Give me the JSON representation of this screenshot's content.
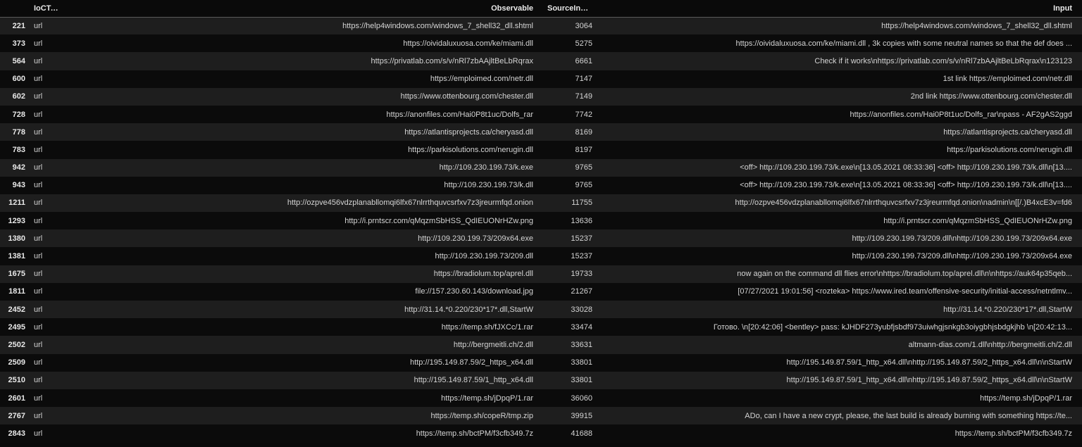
{
  "table": {
    "headers": {
      "index": "",
      "ioc_type": "IoCType",
      "observable": "Observable",
      "source_index": "SourceIndex",
      "input": "Input"
    },
    "rows": [
      {
        "index": "221",
        "ioc_type": "url",
        "observable": "https://help4windows.com/windows_7_shell32_dll.shtml",
        "source_index": "3064",
        "input": "https://help4windows.com/windows_7_shell32_dll.shtml"
      },
      {
        "index": "373",
        "ioc_type": "url",
        "observable": "https://oividaluxuosa.com/ke/miami.dll",
        "source_index": "5275",
        "input": "https://oividaluxuosa.com/ke/miami.dll , 3k copies with some neutral names so that the def does ..."
      },
      {
        "index": "564",
        "ioc_type": "url",
        "observable": "https://privatlab.com/s/v/nRl7zbAAjltBeLbRqrax",
        "source_index": "6661",
        "input": "Check if it works\\nhttps://privatlab.com/s/v/nRl7zbAAjltBeLbRqrax\\n123123"
      },
      {
        "index": "600",
        "ioc_type": "url",
        "observable": "https://emploimed.com/netr.dll",
        "source_index": "7147",
        "input": "1st link https://emploimed.com/netr.dll"
      },
      {
        "index": "602",
        "ioc_type": "url",
        "observable": "https://www.ottenbourg.com/chester.dll",
        "source_index": "7149",
        "input": "2nd link https://www.ottenbourg.com/chester.dll"
      },
      {
        "index": "728",
        "ioc_type": "url",
        "observable": "https://anonfiles.com/Hai0P8t1uc/Dolfs_rar",
        "source_index": "7742",
        "input": "https://anonfiles.com/Hai0P8t1uc/Dolfs_rar\\npass - AF2gAS2ggd"
      },
      {
        "index": "778",
        "ioc_type": "url",
        "observable": "https://atlantisprojects.ca/cheryasd.dll",
        "source_index": "8169",
        "input": "https://atlantisprojects.ca/cheryasd.dll"
      },
      {
        "index": "783",
        "ioc_type": "url",
        "observable": "https://parkisolutions.com/nerugin.dll",
        "source_index": "8197",
        "input": "https://parkisolutions.com/nerugin.dll"
      },
      {
        "index": "942",
        "ioc_type": "url",
        "observable": "http://109.230.199.73/k.exe",
        "source_index": "9765",
        "input": "<off> http://109.230.199.73/k.exe\\n[13.05.2021 08:33:36] <off> http://109.230.199.73/k.dll\\n[13...."
      },
      {
        "index": "943",
        "ioc_type": "url",
        "observable": "http://109.230.199.73/k.dll",
        "source_index": "9765",
        "input": "<off> http://109.230.199.73/k.exe\\n[13.05.2021 08:33:36] <off> http://109.230.199.73/k.dll\\n[13...."
      },
      {
        "index": "1211",
        "ioc_type": "url",
        "observable": "http://ozpve456vdzplanabllomqi6lfx67nlrrthquvcsrfxv7z3jreurmfqd.onion",
        "source_index": "11755",
        "input": "http://ozpve456vdzplanabllomqi6lfx67nlrrthquvcsrfxv7z3jreurmfqd.onion\\nadmin\\n[[/.)B4xcE3v=fd6"
      },
      {
        "index": "1293",
        "ioc_type": "url",
        "observable": "http://i.prntscr.com/qMqzmSbHSS_QdIEUONrHZw.png",
        "source_index": "13636",
        "input": "http://i.prntscr.com/qMqzmSbHSS_QdIEUONrHZw.png"
      },
      {
        "index": "1380",
        "ioc_type": "url",
        "observable": "http://109.230.199.73/209x64.exe",
        "source_index": "15237",
        "input": "http://109.230.199.73/209.dll\\nhttp://109.230.199.73/209x64.exe"
      },
      {
        "index": "1381",
        "ioc_type": "url",
        "observable": "http://109.230.199.73/209.dll",
        "source_index": "15237",
        "input": "http://109.230.199.73/209.dll\\nhttp://109.230.199.73/209x64.exe"
      },
      {
        "index": "1675",
        "ioc_type": "url",
        "observable": "https://bradiolum.top/aprel.dll",
        "source_index": "19733",
        "input": "now again on the command dll flies error\\nhttps://bradiolum.top/aprel.dll\\n\\nhttps://auk64p35qeb..."
      },
      {
        "index": "1811",
        "ioc_type": "url",
        "observable": "file://157.230.60.143/download.jpg",
        "source_index": "21267",
        "input": "[07/27/2021 19:01:56] <rozteka> https://www.ired.team/offensive-security/initial-access/netntlmv..."
      },
      {
        "index": "2452",
        "ioc_type": "url",
        "observable": "http://31.14.*0.220/230*17*.dll,StartW",
        "source_index": "33028",
        "input": "http://31.14.*0.220/230*17*.dll,StartW"
      },
      {
        "index": "2495",
        "ioc_type": "url",
        "observable": "https://temp.sh/fJXCc/1.rar",
        "source_index": "33474",
        "input": "Готово. \\n[20:42:06] <bentley> pass: kJHDF273yubfjsbdf973uiwhgjsnkgb3oiygbhjsbdgkjhb \\n[20:42:13..."
      },
      {
        "index": "2502",
        "ioc_type": "url",
        "observable": "http://bergmeitli.ch/2.dll",
        "source_index": "33631",
        "input": "altmann-dias.com/1.dll\\nhttp://bergmeitli.ch/2.dll"
      },
      {
        "index": "2509",
        "ioc_type": "url",
        "observable": "http://195.149.87.59/2_https_x64.dll",
        "source_index": "33801",
        "input": "http://195.149.87.59/1_http_x64.dll\\nhttp://195.149.87.59/2_https_x64.dll\\n\\nStartW"
      },
      {
        "index": "2510",
        "ioc_type": "url",
        "observable": "http://195.149.87.59/1_http_x64.dll",
        "source_index": "33801",
        "input": "http://195.149.87.59/1_http_x64.dll\\nhttp://195.149.87.59/2_https_x64.dll\\n\\nStartW"
      },
      {
        "index": "2601",
        "ioc_type": "url",
        "observable": "https://temp.sh/jDpqP/1.rar",
        "source_index": "36060",
        "input": "https://temp.sh/jDpqP/1.rar"
      },
      {
        "index": "2767",
        "ioc_type": "url",
        "observable": "https://temp.sh/copeR/tmp.zip",
        "source_index": "39915",
        "input": "ADo, can I have a new crypt, please, the last build is already burning with something https://te..."
      },
      {
        "index": "2843",
        "ioc_type": "url",
        "observable": "https://temp.sh/bctPM/f3cfb349.7z",
        "source_index": "41688",
        "input": "https://temp.sh/bctPM/f3cfb349.7z"
      }
    ]
  }
}
